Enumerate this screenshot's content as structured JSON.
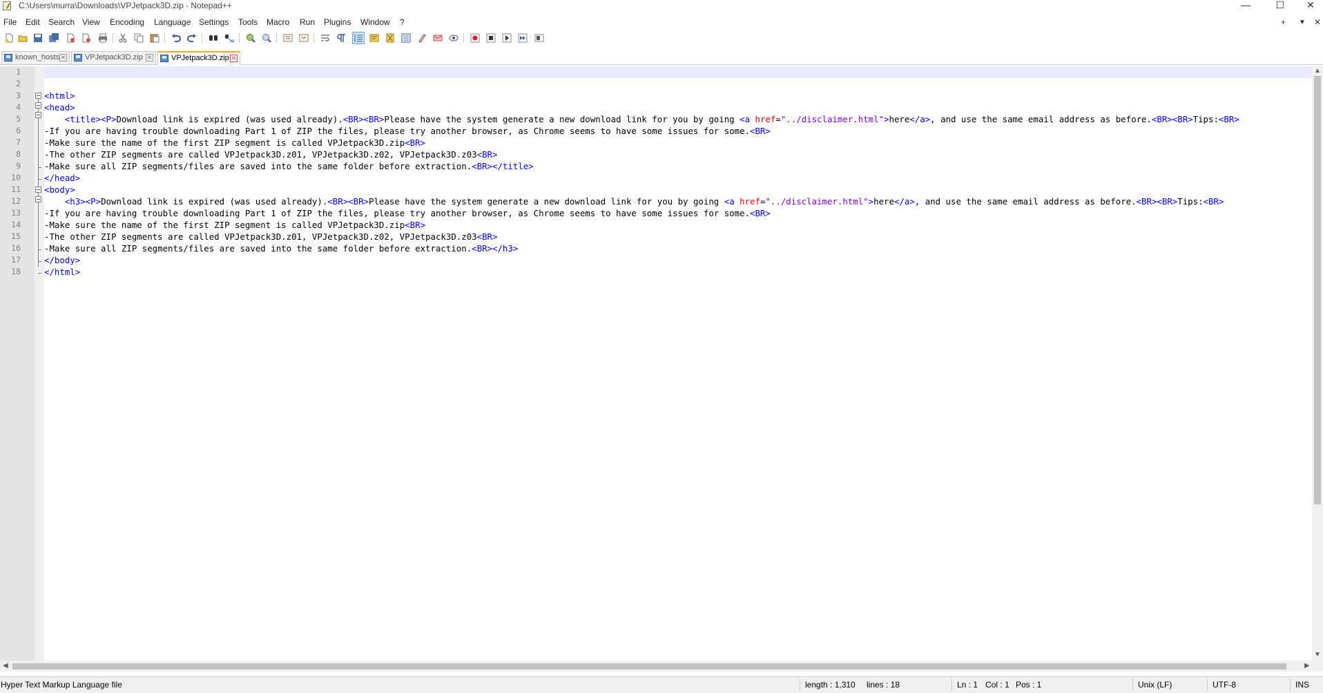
{
  "window": {
    "title": "C:\\Users\\murra\\Downloads\\VPJetpack3D.zip - Notepad++",
    "controls": {
      "minimize": "—",
      "maximize": "☐",
      "close": "✕"
    }
  },
  "menu": {
    "items": [
      "File",
      "Edit",
      "Search",
      "View",
      "Encoding",
      "Language",
      "Settings",
      "Tools",
      "Macro",
      "Run",
      "Plugins",
      "Window",
      "?"
    ],
    "right": {
      "add": "+",
      "dropdown": "▼",
      "close": "✕"
    }
  },
  "tabs": [
    {
      "label": "known_hosts",
      "active": false
    },
    {
      "label": "VPJetpack3D.zip",
      "active": false
    },
    {
      "label": "VPJetpack3D.zip",
      "active": true
    }
  ],
  "editor": {
    "lines": [
      {
        "n": "1",
        "text": ""
      },
      {
        "n": "2",
        "text": ""
      },
      {
        "n": "3",
        "text": "<html>"
      },
      {
        "n": "4",
        "text": "<head>"
      },
      {
        "n": "5",
        "text": "    <title><P>Download link is expired (was used already).<BR><BR>Please have the system generate a new download link for you by going <a href=\"../disclaimer.html\">here</a>, and use the same email address as before.<BR><BR>Tips:<BR>"
      },
      {
        "n": "6",
        "text": "-If you are having trouble downloading Part 1 of ZIP the files, please try another browser, as Chrome seems to have some issues for some.<BR>"
      },
      {
        "n": "7",
        "text": "-Make sure the name of the first ZIP segment is called VPJetpack3D.zip<BR>"
      },
      {
        "n": "8",
        "text": "-The other ZIP segments are called VPJetpack3D.z01, VPJetpack3D.z02, VPJetpack3D.z03<BR>"
      },
      {
        "n": "9",
        "text": "-Make sure all ZIP segments/files are saved into the same folder before extraction.<BR></title>"
      },
      {
        "n": "10",
        "text": "</head>"
      },
      {
        "n": "11",
        "text": "<body>"
      },
      {
        "n": "12",
        "text": "    <h3><P>Download link is expired (was used already).<BR><BR>Please have the system generate a new download link for you by going <a href=\"../disclaimer.html\">here</a>, and use the same email address as before.<BR><BR>Tips:<BR>"
      },
      {
        "n": "13",
        "text": "-If you are having trouble downloading Part 1 of ZIP the files, please try another browser, as Chrome seems to have some issues for some.<BR>"
      },
      {
        "n": "14",
        "text": "-Make sure the name of the first ZIP segment is called VPJetpack3D.zip<BR>"
      },
      {
        "n": "15",
        "text": "-The other ZIP segments are called VPJetpack3D.z01, VPJetpack3D.z02, VPJetpack3D.z03<BR>"
      },
      {
        "n": "16",
        "text": "-Make sure all ZIP segments/files are saved into the same folder before extraction.<BR></h3>"
      },
      {
        "n": "17",
        "text": "</body>"
      },
      {
        "n": "18",
        "text": "</html>"
      }
    ]
  },
  "status": {
    "file_type": "Hyper Text Markup Language file",
    "length": "length : 1,310",
    "lines": "lines : 18",
    "ln": "Ln : 1",
    "col": "Col : 1",
    "pos": "Pos : 1",
    "eol": "Unix (LF)",
    "encoding": "UTF-8",
    "mode": "INS"
  },
  "colors": {
    "tag": "#0000ff",
    "attribute": "#ff0000",
    "attr_value": "#8000ff",
    "active_tab_accent": "#f5a623",
    "current_line": "#e8e8ff"
  },
  "toolbar_icons": [
    "new-file-icon",
    "open-file-icon",
    "save-icon",
    "save-all-icon",
    "close-icon",
    "close-all-icon",
    "print-icon",
    "cut-icon",
    "copy-icon",
    "paste-icon",
    "undo-icon",
    "redo-icon",
    "find-icon",
    "replace-icon",
    "zoom-in-icon",
    "zoom-out-icon",
    "sync-vertical-icon",
    "sync-horizontal-icon",
    "word-wrap-icon",
    "show-all-chars-icon",
    "indent-guide-icon",
    "udl-icon",
    "doc-map-icon",
    "function-list-icon",
    "folder-workspace-icon",
    "monitoring-icon",
    "record-macro-icon",
    "stop-macro-icon",
    "play-macro-icon",
    "run-macro-multiple-icon",
    "save-macro-icon"
  ]
}
